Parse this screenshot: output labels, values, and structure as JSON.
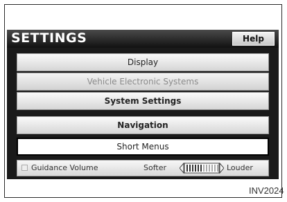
{
  "header": {
    "title": "SETTINGS",
    "help_label": "Help"
  },
  "menu": {
    "items": [
      {
        "label": "Display",
        "state": "normal"
      },
      {
        "label": "Vehicle Electronic Systems",
        "state": "disabled"
      },
      {
        "label": "System Settings",
        "state": "normal-bold"
      },
      {
        "label": "Navigation",
        "state": "normal-bold"
      },
      {
        "label": "Short Menus",
        "state": "selected"
      }
    ]
  },
  "guidance_volume": {
    "label": "Guidance Volume",
    "softer_label": "Softer",
    "louder_label": "Louder",
    "level_fraction": 0.5
  },
  "figure_id": "INV2024",
  "colors": {
    "header_bg": "#1a1a1a",
    "button_face": "#e6e6e6",
    "selected_border": "#000000"
  }
}
